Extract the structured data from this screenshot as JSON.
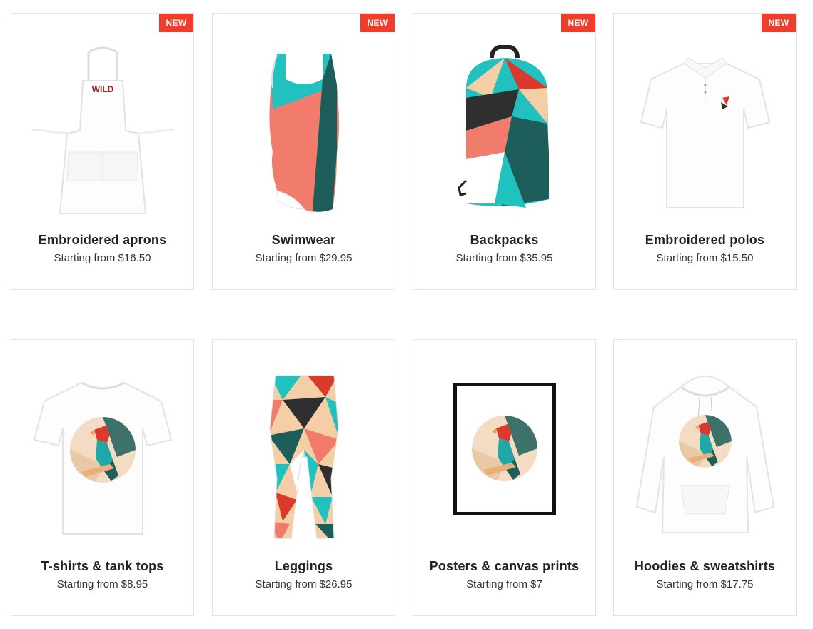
{
  "colors": {
    "badge": "#ee3d2c",
    "teal": "#21c1c0",
    "coral": "#f27c6c",
    "dark_teal": "#1d5e5a",
    "peach": "#f4cfa6",
    "red": "#d93a2b",
    "charcoal": "#2f2f2f"
  },
  "products": [
    {
      "title": "Embroidered aprons",
      "price": "Starting from $16.50",
      "badge": "NEW",
      "icon": "apron-icon",
      "print": "WILD"
    },
    {
      "title": "Swimwear",
      "price": "Starting from $29.95",
      "badge": "NEW",
      "icon": "swimsuit-icon"
    },
    {
      "title": "Backpacks",
      "price": "Starting from $35.95",
      "badge": "NEW",
      "icon": "backpack-icon"
    },
    {
      "title": "Embroidered polos",
      "price": "Starting from $15.50",
      "badge": "NEW",
      "icon": "polo-shirt-icon"
    },
    {
      "title": "T-shirts & tank tops",
      "price": "Starting from $8.95",
      "icon": "tshirt-icon"
    },
    {
      "title": "Leggings",
      "price": "Starting from $26.95",
      "icon": "leggings-icon"
    },
    {
      "title": "Posters & canvas prints",
      "price": "Starting from $7",
      "icon": "poster-icon"
    },
    {
      "title": "Hoodies & sweatshirts",
      "price": "Starting from $17.75",
      "icon": "hoodie-icon"
    }
  ]
}
